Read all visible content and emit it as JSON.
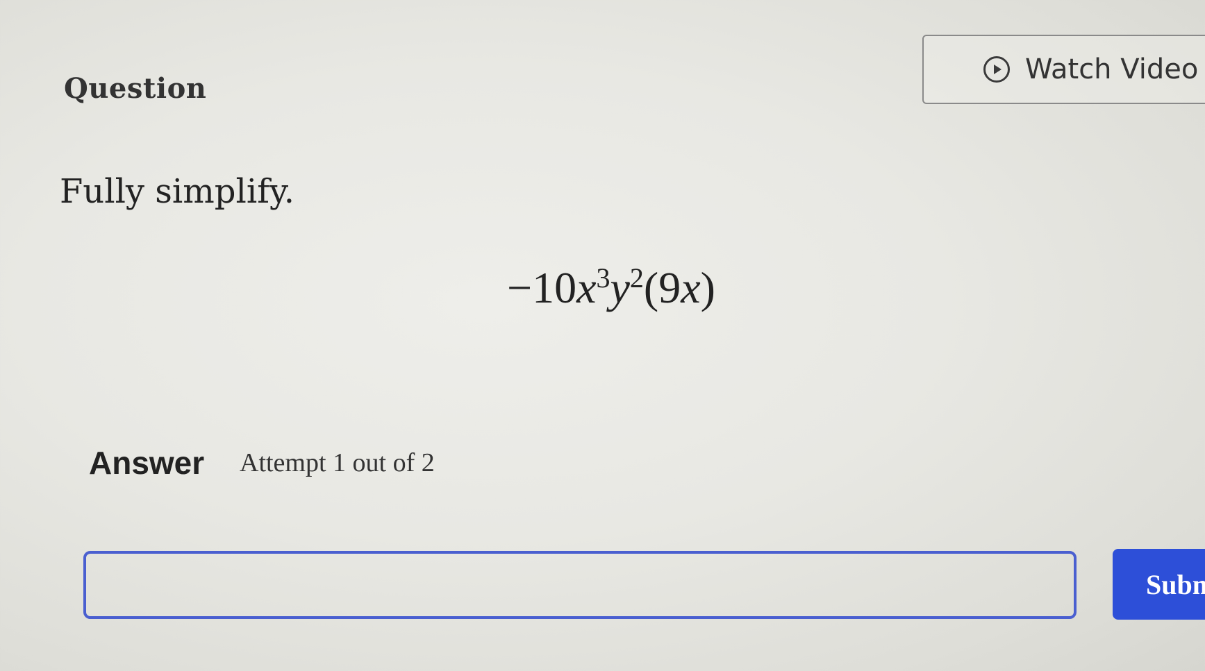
{
  "header": {
    "question_label": "Question",
    "watch_video_label": "Watch Video",
    "watch_video_icon": "play-circle-icon"
  },
  "question": {
    "prompt": "Fully simplify.",
    "expression": {
      "minus": "−",
      "coefficient": "10",
      "var1": "x",
      "exp1": "3",
      "var2": "y",
      "exp2": "2",
      "open_paren": "(",
      "inner_coefficient": "9",
      "inner_var": "x",
      "close_paren": ")"
    }
  },
  "answer": {
    "label": "Answer",
    "attempt_text": "Attempt 1 out of 2",
    "input_value": "",
    "submit_label": "Subm"
  },
  "colors": {
    "accent": "#2d4fd8",
    "input_border": "#4a5fd0"
  }
}
